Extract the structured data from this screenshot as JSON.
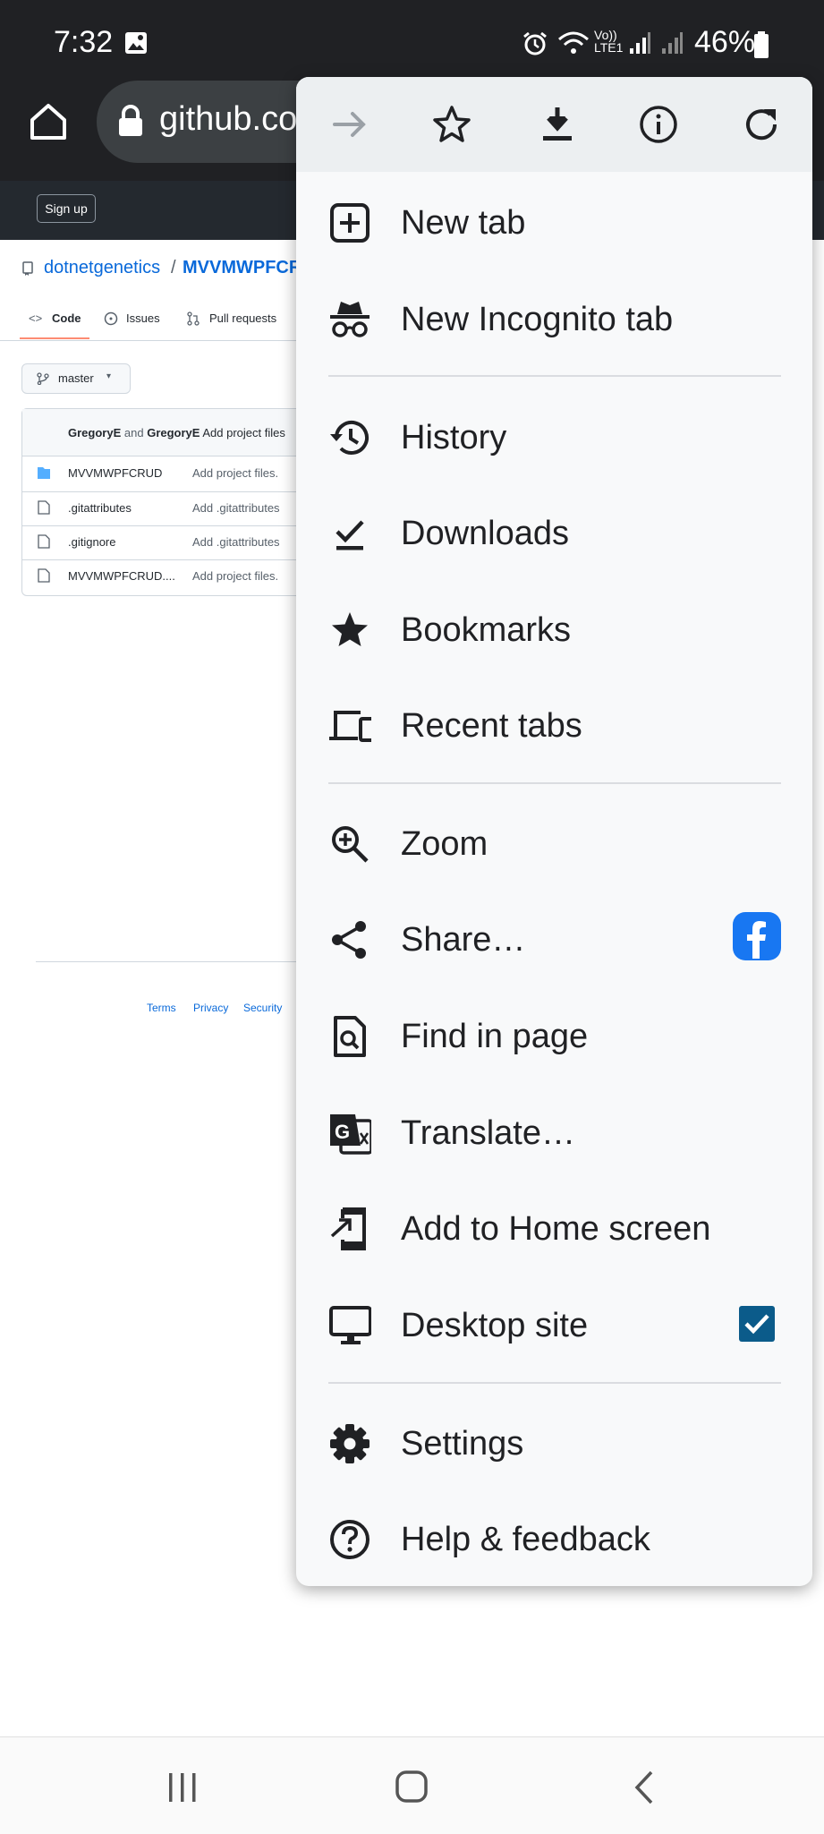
{
  "status": {
    "time": "7:32",
    "battery": "46%",
    "network": "Vo)) LTE1"
  },
  "browser": {
    "url": "github.co"
  },
  "github": {
    "signup": "Sign up",
    "owner": "dotnetgenetics",
    "separator": "/",
    "repo": "MVVMWPFCR",
    "tabs": [
      {
        "label": "Code"
      },
      {
        "label": "Issues"
      },
      {
        "label": "Pull requests"
      }
    ],
    "branch": "master",
    "commit": {
      "author1": "GregoryE",
      "and": "and",
      "author2": "GregoryE",
      "message": "Add project files"
    },
    "files": [
      {
        "name": "MVVMWPFCRUD",
        "message": "Add project files.",
        "type": "folder"
      },
      {
        "name": ".gitattributes",
        "message": "Add .gitattributes",
        "type": "file"
      },
      {
        "name": ".gitignore",
        "message": "Add .gitattributes",
        "type": "file"
      },
      {
        "name": "MVVMWPFCRUD....",
        "message": "Add project files.",
        "type": "file"
      }
    ],
    "footer": {
      "terms": "Terms",
      "privacy": "Privacy",
      "security": "Security"
    }
  },
  "menu": {
    "top_icons": [
      "forward-icon",
      "bookmark-star-icon",
      "download-icon",
      "info-icon",
      "reload-icon"
    ],
    "items": [
      {
        "label": "New tab",
        "icon": "new-tab-icon"
      },
      {
        "label": "New Incognito tab",
        "icon": "incognito-icon"
      },
      {
        "label": "History",
        "icon": "history-icon"
      },
      {
        "label": "Downloads",
        "icon": "downloads-icon"
      },
      {
        "label": "Bookmarks",
        "icon": "bookmarks-icon"
      },
      {
        "label": "Recent tabs",
        "icon": "recent-tabs-icon"
      },
      {
        "label": "Zoom",
        "icon": "zoom-icon"
      },
      {
        "label": "Share…",
        "icon": "share-icon"
      },
      {
        "label": "Find in page",
        "icon": "find-in-page-icon"
      },
      {
        "label": "Translate…",
        "icon": "translate-icon"
      },
      {
        "label": "Add to Home screen",
        "icon": "add-to-home-icon"
      },
      {
        "label": "Desktop site",
        "icon": "desktop-icon",
        "checked": true
      },
      {
        "label": "Settings",
        "icon": "settings-icon"
      },
      {
        "label": "Help & feedback",
        "icon": "help-icon"
      }
    ]
  },
  "colors": {
    "accent": "#1a73e8",
    "checkbox": "#0b5b8a",
    "facebook": "#1877f2",
    "dark_bar": "#202124"
  }
}
